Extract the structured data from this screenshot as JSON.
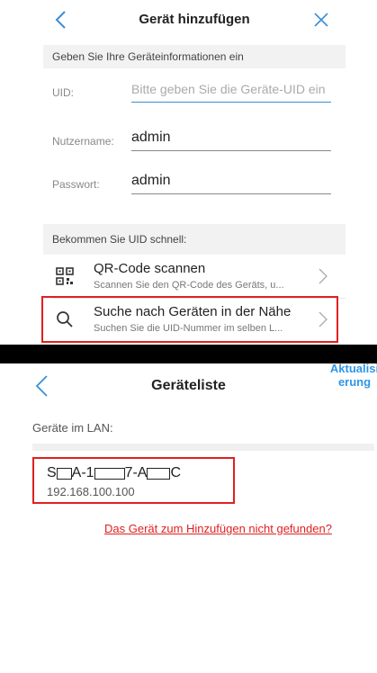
{
  "add_device": {
    "title": "Gerät hinzufügen",
    "section_info": "Geben Sie Ihre Geräteinformationen ein",
    "uid": {
      "label": "UID:",
      "placeholder": "Bitte geben Sie die Geräte-UID ein"
    },
    "username": {
      "label": "Nutzername:",
      "value": "admin"
    },
    "password": {
      "label": "Passwort:",
      "value": "admin"
    },
    "section_quick": "Bekommen Sie UID schnell:",
    "menu": [
      {
        "title": "QR-Code scannen",
        "subtitle": "Scannen Sie den QR-Code des Geräts, u...",
        "icon": "qr-code-icon"
      },
      {
        "title": "Suche nach Geräten in der Nähe",
        "subtitle": "Suchen Sie die UID-Nummer im selben L...",
        "icon": "search-icon"
      }
    ]
  },
  "device_list": {
    "title": "Geräteliste",
    "refresh_label": [
      "Aktualisi",
      "erung"
    ],
    "lan_label": "Geräte im LAN:",
    "device": {
      "name_parts": [
        "S",
        "A-1",
        "7-A",
        "C"
      ],
      "ip": "192.168.100.100"
    },
    "not_found_link": "Das Gerät zum Hinzufügen nicht gefunden?"
  },
  "colors": {
    "accent_blue": "#2f96e6",
    "highlight_red": "#e02020",
    "link_red": "#e02020"
  }
}
